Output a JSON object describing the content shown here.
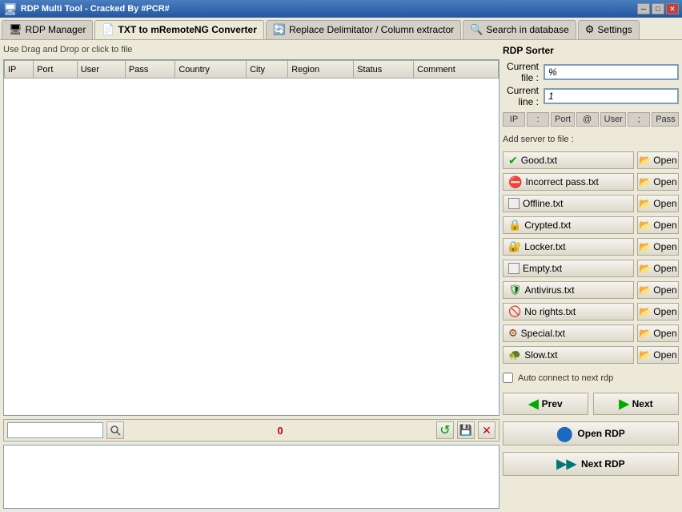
{
  "titleBar": {
    "title": "RDP Multi Tool - Cracked By #PCR#",
    "icon": "🖥",
    "minBtn": "─",
    "maxBtn": "□",
    "closeBtn": "✕"
  },
  "tabs": [
    {
      "id": "rdp-manager",
      "label": "RDP Manager",
      "icon": "🖥",
      "active": false
    },
    {
      "id": "txt-converter",
      "label": "TXT to mRemoteNG Converter",
      "icon": "📄",
      "active": true
    },
    {
      "id": "replace-delimitator",
      "label": "Replace Delimitator / Column extractor",
      "icon": "🔄",
      "active": false
    },
    {
      "id": "search-db",
      "label": "Search in database",
      "icon": "🔍",
      "active": false
    },
    {
      "id": "settings",
      "label": "Settings",
      "icon": "⚙",
      "active": false
    }
  ],
  "leftPanel": {
    "dragHint": "Use Drag and Drop or click to file",
    "tableColumns": [
      "IP",
      "Port",
      "User",
      "Pass",
      "Country",
      "City",
      "Region",
      "Status",
      "Comment"
    ],
    "tableRows": [],
    "counter": "0",
    "searchPlaceholder": ""
  },
  "rightPanel": {
    "title": "RDP Sorter",
    "currentFileLabel": "Current file :",
    "currentFileValue": "%",
    "currentLineLabel": "Current line :",
    "currentLineValue": "1",
    "separators": [
      {
        "label": "IP",
        "active": false
      },
      {
        "label": ":",
        "active": false
      },
      {
        "label": "Port",
        "active": false
      },
      {
        "label": "@",
        "active": false
      },
      {
        "label": "User",
        "active": false
      },
      {
        "label": ";",
        "active": false
      },
      {
        "label": "Pass",
        "active": false
      }
    ],
    "addServerLabel": "Add server to file :",
    "fileButtons": [
      {
        "icon": "✅",
        "label": "Good.txt",
        "iconType": "green-check"
      },
      {
        "icon": "🚫",
        "label": "Incorrect pass.txt",
        "iconType": "red-block"
      },
      {
        "icon": "⬜",
        "label": "Offline.txt",
        "iconType": "empty"
      },
      {
        "icon": "🔒",
        "label": "Crypted.txt",
        "iconType": "lock-gray"
      },
      {
        "icon": "🔐",
        "label": "Locker.txt",
        "iconType": "lock"
      },
      {
        "icon": "⬜",
        "label": "Empty.txt",
        "iconType": "empty"
      },
      {
        "icon": "🛡",
        "label": "Antivirus.txt",
        "iconType": "shield"
      },
      {
        "icon": "⛔",
        "label": "No rights.txt",
        "iconType": "no-entry"
      },
      {
        "icon": "⚙",
        "label": "Special.txt",
        "iconType": "gear"
      },
      {
        "icon": "🐢",
        "label": "Slow.txt",
        "iconType": "slow"
      }
    ],
    "openBtnLabel": "Open",
    "openBtnIcon": "📂",
    "autoConnectLabel": "Auto connect to next rdp",
    "prevBtnLabel": "Prev",
    "nextBtnLabel": "Next",
    "openRdpLabel": "Open RDP",
    "nextRdpLabel": "Next RDP"
  }
}
